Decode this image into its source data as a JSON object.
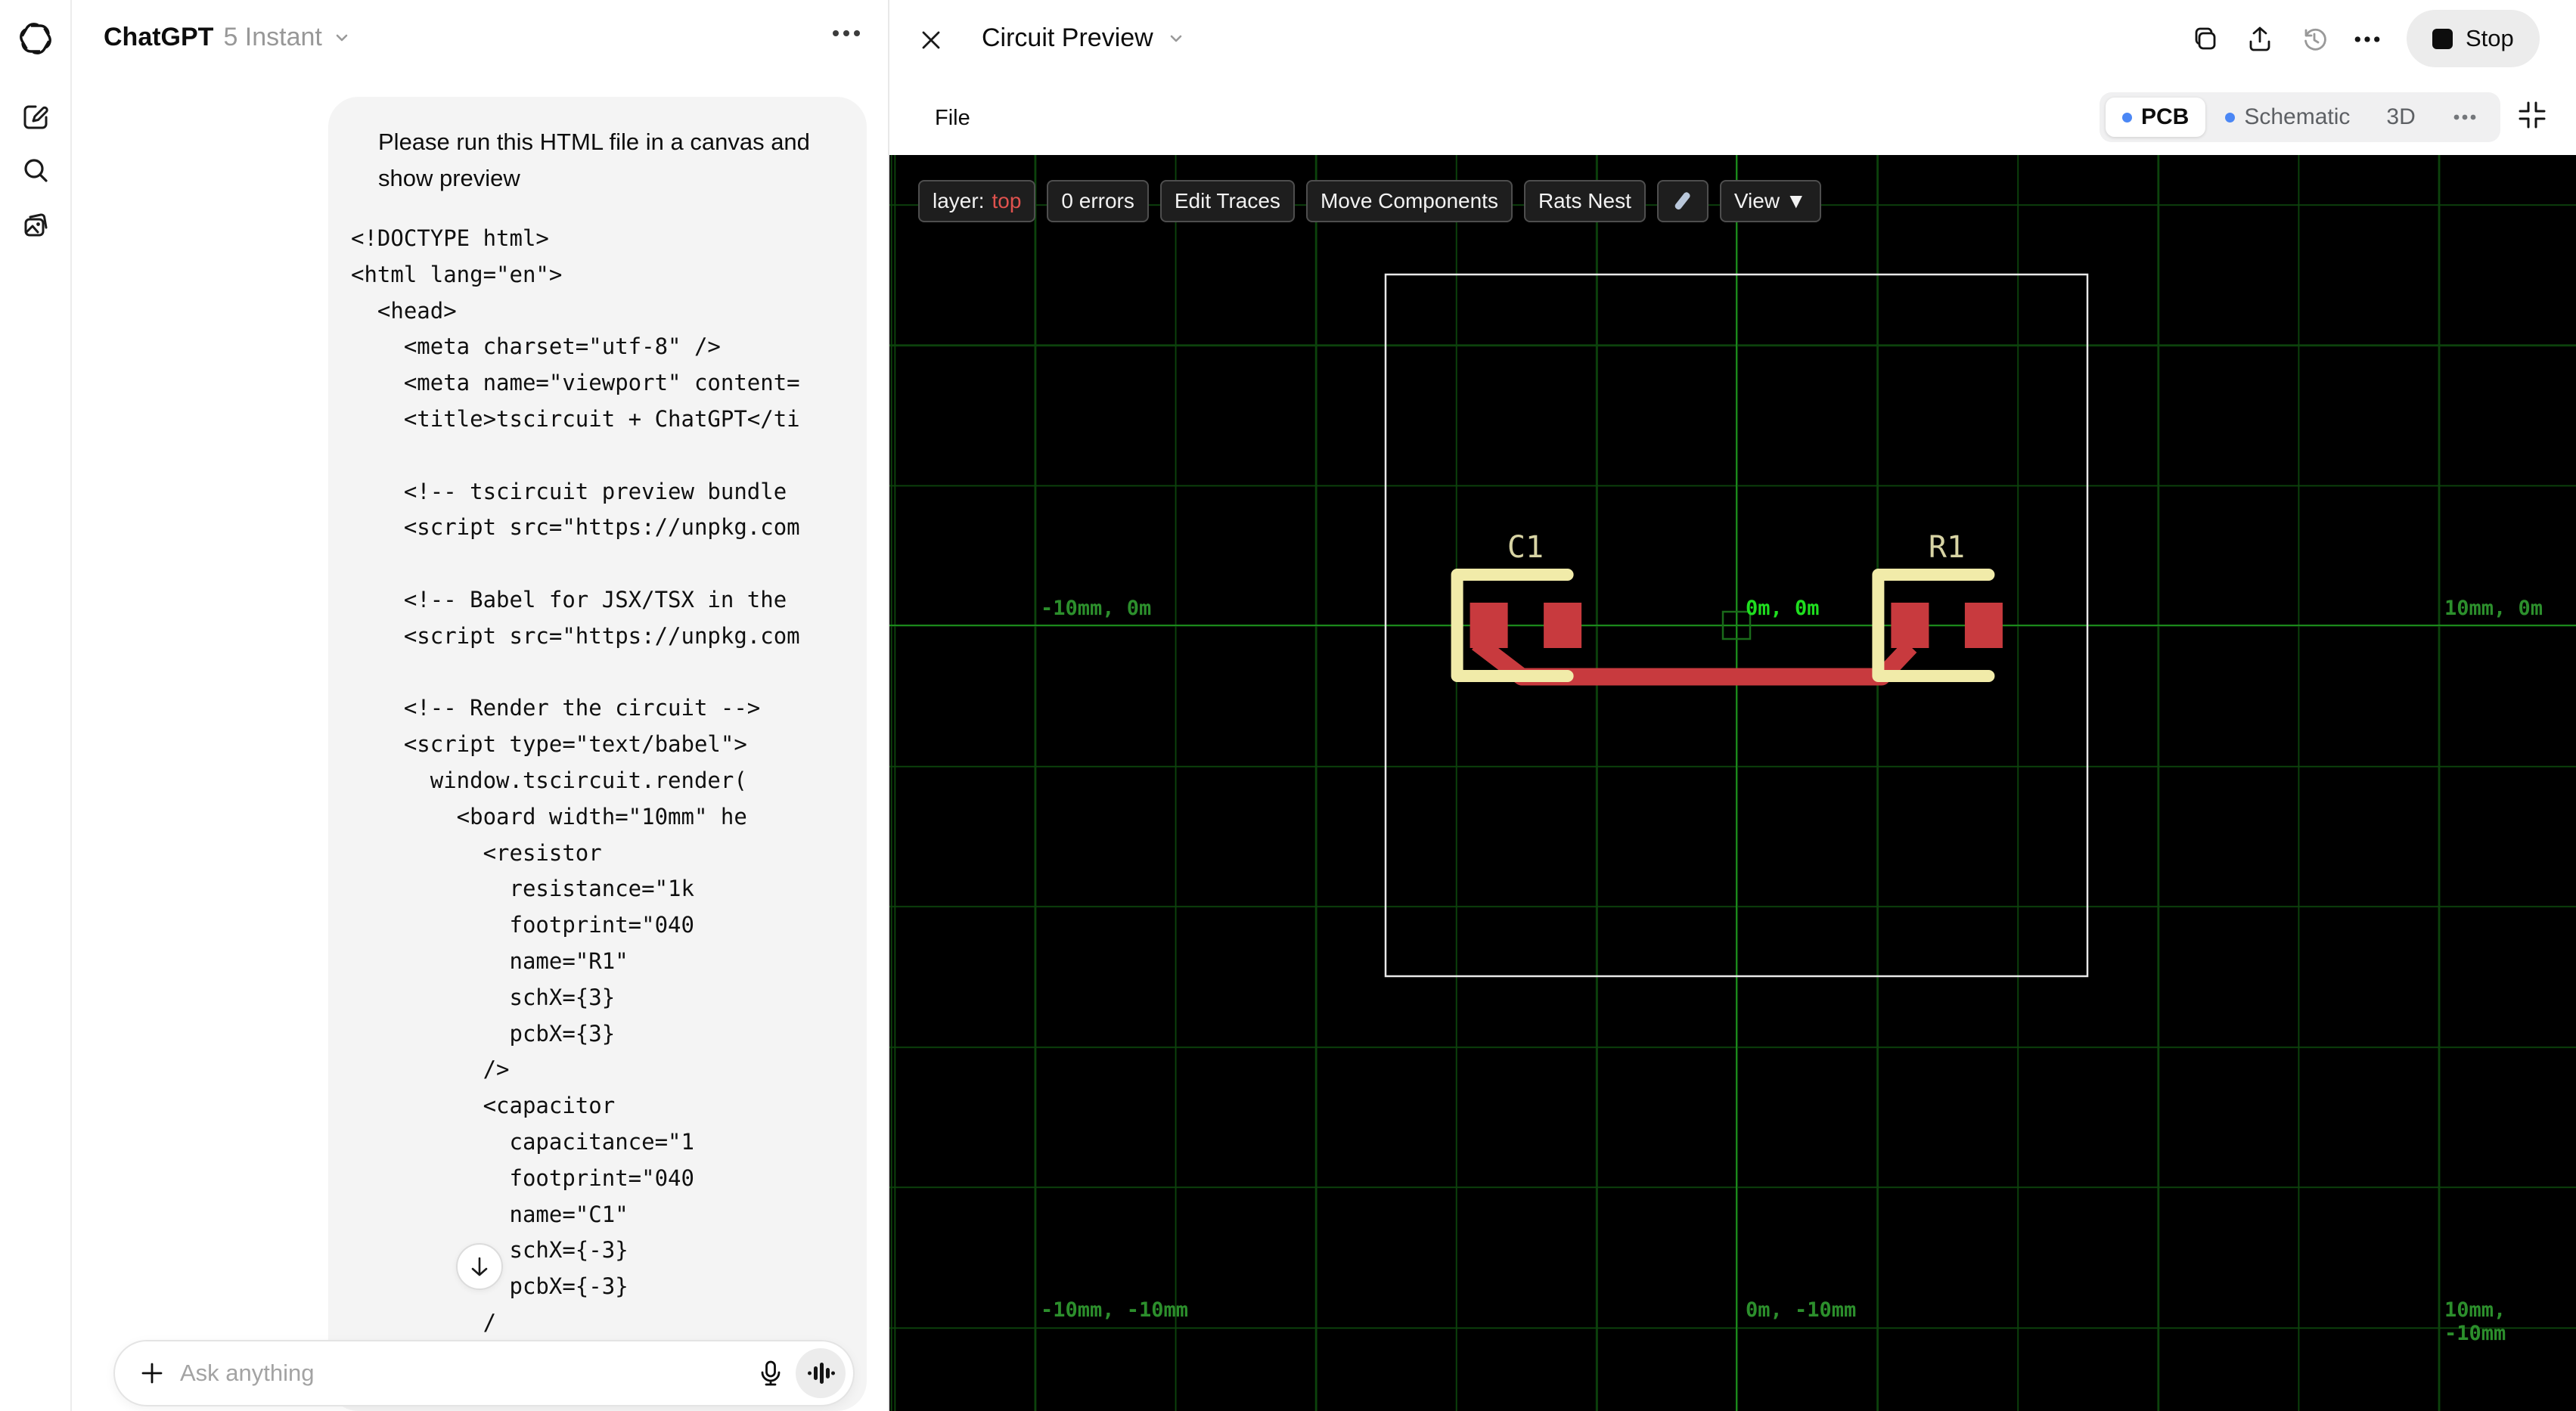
{
  "sidebar": {
    "logo": "openai-logo",
    "items": [
      "new-chat",
      "search",
      "library"
    ]
  },
  "chat": {
    "header": {
      "title": "ChatGPT",
      "model": "5 Instant"
    },
    "message_lines": "Please run this HTML file in a canvas and\nshow preview",
    "code_lines": [
      "<!DOCTYPE html>",
      "<html lang=\"en\">",
      "  <head>",
      "    <meta charset=\"utf-8\" />",
      "    <meta name=\"viewport\" content=",
      "    <title>tscircuit + ChatGPT</ti",
      "",
      "    <!-- tscircuit preview bundle",
      "    <script src=\"https://unpkg.com",
      "",
      "    <!-- Babel for JSX/TSX in the",
      "    <script src=\"https://unpkg.com",
      "",
      "    <!-- Render the circuit -->",
      "    <script type=\"text/babel\">",
      "      window.tscircuit.render(",
      "        <board width=\"10mm\" he",
      "          <resistor",
      "            resistance=\"1k",
      "            footprint=\"040",
      "            name=\"R1\"",
      "            schX={3}",
      "            pcbX={3}",
      "          />",
      "          <capacitor",
      "            capacitance=\"1",
      "            footprint=\"040",
      "            name=\"C1\"",
      "            schX={-3}",
      "            pcbX={-3}",
      "          /"
    ],
    "input_placeholder": "Ask anything"
  },
  "panel": {
    "title": "Circuit Preview",
    "stop_label": "Stop",
    "file_menu": "File",
    "tabs": {
      "pcb": "PCB",
      "schematic": "Schematic",
      "threed": "3D"
    },
    "toolbar": {
      "layer_prefix": "layer:",
      "layer_value": "top",
      "errors": "0 errors",
      "edit_traces": "Edit Traces",
      "move_components": "Move Components",
      "rats_nest": "Rats Nest",
      "view": "View ▼"
    },
    "pcb": {
      "board": {
        "width": "10mm",
        "height": "10mm"
      },
      "components": [
        {
          "name": "C1",
          "pcbX": -3
        },
        {
          "name": "R1",
          "pcbX": 3
        }
      ],
      "grid_labels": {
        "mid_left": "-10mm, 0m",
        "origin": "0m, 0m",
        "mid_right": "10mm, 0m",
        "bottom_left": "-10mm, -10mm",
        "bottom_center": "0m, -10mm",
        "bottom_right": "10mm, -10mm"
      }
    }
  }
}
